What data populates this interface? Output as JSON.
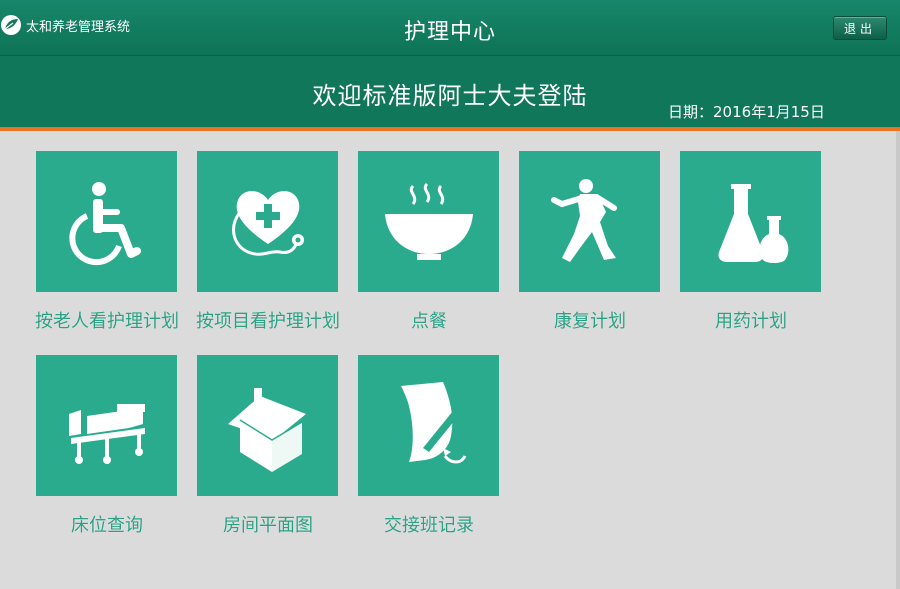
{
  "header": {
    "brand": "太和养老管理系统",
    "title": "护理中心",
    "logout_label": "退出"
  },
  "welcome": {
    "message": "欢迎标准版阿士大夫登陆",
    "date_label": "日期：",
    "date_value": "2016年1月15日"
  },
  "tiles": [
    {
      "label": "按老人看护理计划",
      "icon": "wheelchair-icon"
    },
    {
      "label": "按项目看护理计划",
      "icon": "heart-stethoscope-icon"
    },
    {
      "label": "点餐",
      "icon": "bowl-icon"
    },
    {
      "label": "康复计划",
      "icon": "martial-arts-icon"
    },
    {
      "label": "用药计划",
      "icon": "flask-icon"
    },
    {
      "label": "床位查询",
      "icon": "hospital-bed-icon"
    },
    {
      "label": "房间平面图",
      "icon": "house-icon"
    },
    {
      "label": "交接班记录",
      "icon": "document-pen-icon"
    }
  ],
  "colors": {
    "header_green": "#10775a",
    "tile_green": "#2bab8e",
    "label_green": "#2aa184",
    "accent_orange": "#e9731f",
    "background": "#dcdbdb"
  }
}
